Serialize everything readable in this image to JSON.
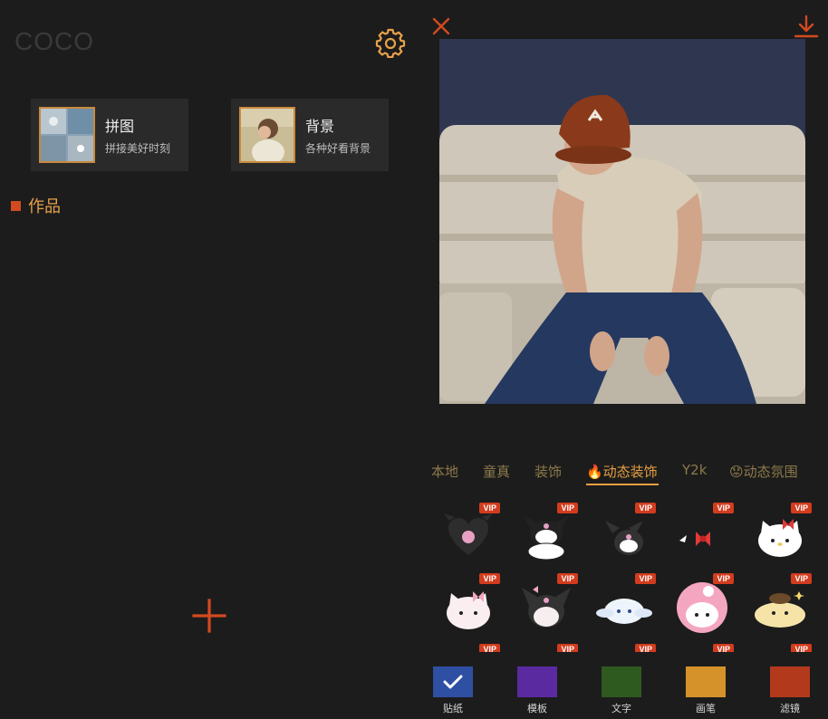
{
  "app": {
    "title": "COCO"
  },
  "home_cards": [
    {
      "title": "拼图",
      "subtitle": "拼接美好时刻"
    },
    {
      "title": "背景",
      "subtitle": "各种好看背景"
    }
  ],
  "works_label": "作品",
  "tabs": [
    "本地",
    "童真",
    "装饰",
    "🔥动态装饰",
    "Y2k",
    "😟动态氛围"
  ],
  "active_tab": "🔥动态装饰",
  "vip_badge": "VIP",
  "stickers": [
    "kuromi-heart-sticker",
    "kuromi-sticker",
    "kuromi-head-sticker",
    "bow-sticker",
    "hello-kitty-sticker",
    "hello-kitty-plush-sticker",
    "kuromi-plush-sticker",
    "cinnamoroll-sticker",
    "my-melody-sticker",
    "pompompurin-sticker"
  ],
  "toolbar": [
    {
      "label": "贴纸",
      "color": "#2f4fa3",
      "selected": true
    },
    {
      "label": "模板",
      "color": "#5a2aa0",
      "selected": false
    },
    {
      "label": "文字",
      "color": "#2f5a1f",
      "selected": false
    },
    {
      "label": "画笔",
      "color": "#d6922a",
      "selected": false
    },
    {
      "label": "滤镜",
      "color": "#b3391d",
      "selected": false
    }
  ],
  "colors": {
    "accent": "#e7a043",
    "brand_red": "#d24a1f",
    "vip_red": "#d23c1e"
  }
}
